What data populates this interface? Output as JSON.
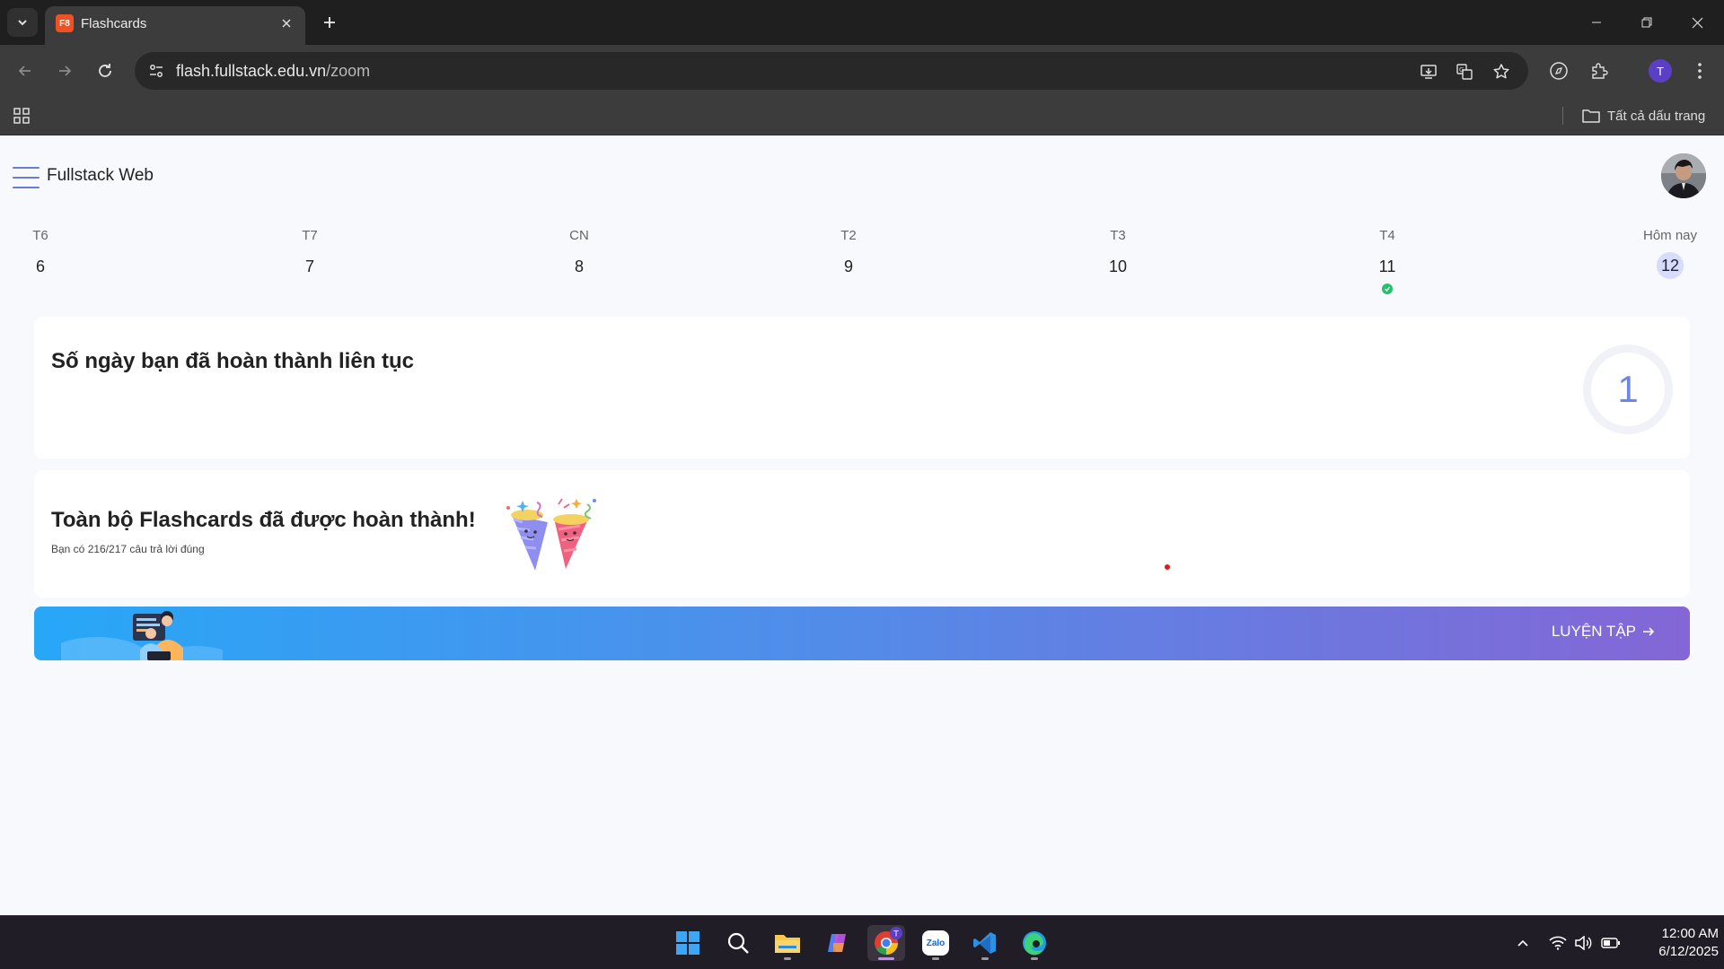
{
  "browser": {
    "tab": {
      "favicon_text": "F8",
      "title": "Flashcards"
    },
    "url": {
      "host": "flash.fullstack.edu.vn",
      "path": "/zoom"
    },
    "bookmarks": {
      "all_bookmarks_label": "Tất cả dấu trang"
    },
    "profile_initial": "T"
  },
  "page": {
    "brand": "Fullstack Web",
    "calendar": [
      {
        "weekday": "T6",
        "day": "6",
        "done": false,
        "today": false
      },
      {
        "weekday": "T7",
        "day": "7",
        "done": false,
        "today": false
      },
      {
        "weekday": "CN",
        "day": "8",
        "done": false,
        "today": false
      },
      {
        "weekday": "T2",
        "day": "9",
        "done": false,
        "today": false
      },
      {
        "weekday": "T3",
        "day": "10",
        "done": false,
        "today": false
      },
      {
        "weekday": "T4",
        "day": "11",
        "done": true,
        "today": false
      },
      {
        "weekday": "Hôm nay",
        "day": "12",
        "done": false,
        "today": true
      }
    ],
    "streak": {
      "title": "Số ngày bạn đã hoàn thành liên tục",
      "value": "1"
    },
    "completion": {
      "title": "Toàn bộ Flashcards đã được hoàn thành!",
      "subtitle": "Bạn có 216/217 câu trả lời đúng"
    },
    "practice": {
      "label": "LUYỆN TẬP"
    }
  },
  "taskbar": {
    "apps": [
      "start-icon",
      "search-icon",
      "file-explorer-icon",
      "copilot-icon",
      "chrome-icon",
      "zalo-icon",
      "vscode-icon",
      "edge-icon"
    ],
    "zalo_label": "Zalo",
    "chrome_badge": "T",
    "time": "12:00 AM",
    "date": "6/12/2025"
  },
  "colors": {
    "accent": "#6e87e6",
    "done_dot": "#23c16b",
    "today_bg": "#d7dcfb",
    "favicon": "#f05123"
  }
}
